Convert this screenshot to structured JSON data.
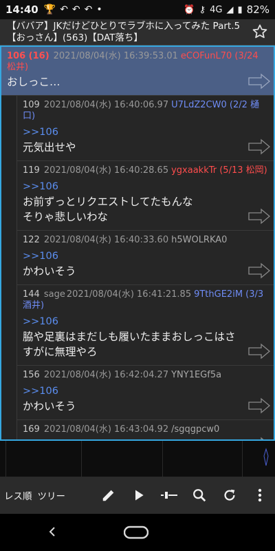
{
  "status": {
    "time": "14:40",
    "network": "4G",
    "battery": "82%"
  },
  "thread": {
    "title": "【ババア】JKだけどひとりでラブホに入ってみた Part.5【おっさん】(563)【DAT落ち】"
  },
  "posts": [
    {
      "num": "106 (16)",
      "mail": "",
      "date": "2021/08/04(水) 16:39:53.01",
      "id": "eCOFunL70 (3/24 松井)",
      "id_color": "red",
      "anchor": "",
      "body": "おしっこ…",
      "highlight": true,
      "reply": false
    },
    {
      "num": "109",
      "mail": "",
      "date": "2021/08/04(水) 16:40:06.97",
      "id": "U7LdZ2CW0 (2/2 樋口)",
      "id_color": "blue",
      "anchor": ">>106",
      "body": "元気出せや",
      "highlight": false,
      "reply": true
    },
    {
      "num": "119",
      "mail": "",
      "date": "2021/08/04(水) 16:40:28.65",
      "id": "ygxaakkTr (5/13 松岡)",
      "id_color": "red",
      "anchor": ">>106",
      "body": "お前ずっとリクエストしてたもんな\nそりゃ悲しいわな",
      "highlight": false,
      "reply": true
    },
    {
      "num": "122",
      "mail": "",
      "date": "2021/08/04(水) 16:40:33.60",
      "id": "h5WOLRKA0",
      "id_color": "gray",
      "anchor": ">>106",
      "body": "かわいそう",
      "highlight": false,
      "reply": true
    },
    {
      "num": "144",
      "mail": "sage",
      "date": "2021/08/04(水) 16:41:21.85",
      "id": "9TthGE2iM (3/3 酒井)",
      "id_color": "blue",
      "anchor": ">>106",
      "body": "脇や足裏はまだしも履いたままおしっこはさすがに無理やろ",
      "highlight": false,
      "reply": true
    },
    {
      "num": "156",
      "mail": "",
      "date": "2021/08/04(水) 16:42:04.27",
      "id": "YNY1EGf5a",
      "id_color": "gray",
      "anchor": ">>106",
      "body": "かわいそう",
      "highlight": false,
      "reply": true
    },
    {
      "num": "169",
      "mail": "",
      "date": "2021/08/04(水) 16:43:04.92",
      "id": "/sgqgpcw0",
      "id_color": "gray",
      "anchor": ">>106",
      "body": "",
      "highlight": false,
      "reply": true
    }
  ],
  "toolbar": {
    "tab_order": "レス順",
    "tab_tree": "ツリー",
    "icons": [
      "pencil-icon",
      "play-icon",
      "slider-icon",
      "search-icon",
      "refresh-icon",
      "more-icon"
    ]
  },
  "colors": {
    "accent_border": "#35a7e0",
    "highlight_bg": "#4b5f86",
    "id_red": "#ff4d4d",
    "id_blue": "#6f8cf5",
    "anchor": "#5b8ef0"
  }
}
